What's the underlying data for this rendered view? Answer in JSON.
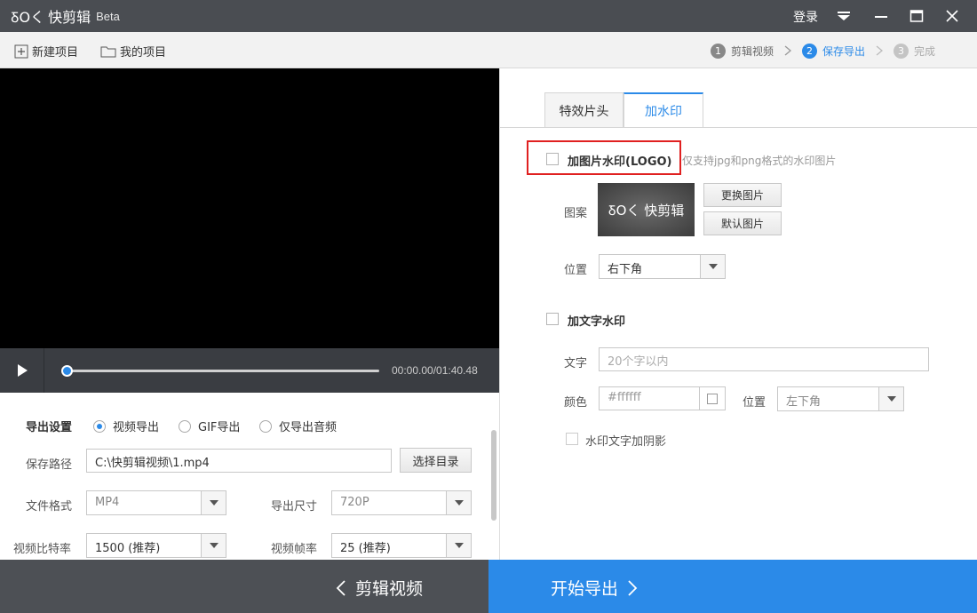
{
  "titlebar": {
    "logo_mark": "ꝽOく",
    "app_name": "快剪辑",
    "beta": "Beta",
    "login": "登录"
  },
  "toolbar": {
    "new_project": "新建项目",
    "my_projects": "我的项目"
  },
  "steps": [
    {
      "num": "1",
      "label": "剪辑视频",
      "state": "done-prev"
    },
    {
      "num": "2",
      "label": "保存导出",
      "state": "active"
    },
    {
      "num": "3",
      "label": "完成",
      "state": "pending"
    }
  ],
  "player": {
    "timecode": "00:00.00/01:40.48",
    "progress": 0
  },
  "export": {
    "section_label": "导出设置",
    "options": [
      "视频导出",
      "GIF导出",
      "仅导出音频"
    ],
    "selected_option": "视频导出",
    "path_label": "保存路径",
    "path_value": "C:\\快剪辑视频\\1.mp4",
    "choose_dir": "选择目录",
    "format_label": "文件格式",
    "format_value": "MP4",
    "size_label": "导出尺寸",
    "size_value": "720P",
    "bitrate_label": "视频比特率",
    "bitrate_value": "1500 (推荐)",
    "framerate_label": "视频帧率",
    "framerate_value": "25 (推荐)"
  },
  "tabs": {
    "effects": "特效片头",
    "watermark": "加水印"
  },
  "watermark": {
    "image_checkbox_label": "加图片水印(LOGO)",
    "image_hint": "仅支持jpg和png格式的水印图片",
    "pattern_label": "图案",
    "preview_text": "ꝽOく 快剪辑",
    "replace_image": "更换图片",
    "default_image": "默认图片",
    "position_label": "位置",
    "position_value": "右下角",
    "text_checkbox_label": "加文字水印",
    "text_label": "文字",
    "text_placeholder": "20个字以内",
    "color_label": "颜色",
    "color_value": "#ffffff",
    "text_position_label": "位置",
    "text_position_value": "左下角",
    "shadow_label": "水印文字加阴影"
  },
  "bottom": {
    "back": "剪辑视频",
    "start_export": "开始导出"
  },
  "colors": {
    "accent": "#2b8ae8",
    "titlebar": "#4a4d52",
    "highlight": "#e02020"
  }
}
